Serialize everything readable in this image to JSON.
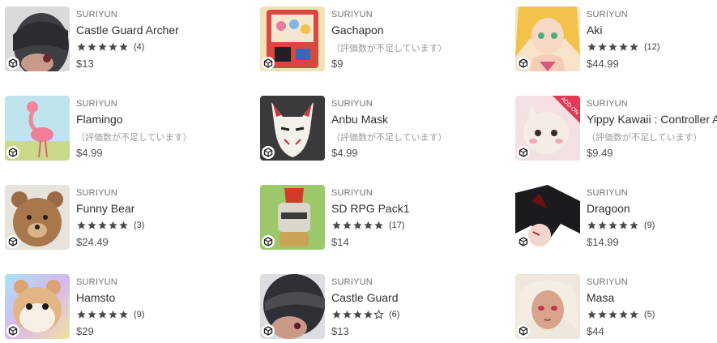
{
  "products": [
    {
      "publisher": "SURIYUN",
      "title": "Castle Guard Archer",
      "stars": 5,
      "count": "(4)",
      "price": "$13"
    },
    {
      "publisher": "SURIYUN",
      "title": "Gachapon",
      "note": "（評価数が不足しています）",
      "price": "$9"
    },
    {
      "publisher": "SURIYUN",
      "title": "Aki",
      "stars": 5,
      "count": "(12)",
      "price": "$44.99"
    },
    {
      "publisher": "SURIYUN",
      "title": "Flamingo",
      "note": "（評価数が不足しています）",
      "price": "$4.99"
    },
    {
      "publisher": "SURIYUN",
      "title": "Anbu Mask",
      "note": "（評価数が不足しています）",
      "price": "$4.99"
    },
    {
      "publisher": "SURIYUN",
      "title": "Yippy Kawaii : Controller Add-on",
      "note": "（評価数が不足しています）",
      "price": "$9.49",
      "thumb_ribbon": "ADD-ON"
    },
    {
      "publisher": "SURIYUN",
      "title": "Funny Bear",
      "stars": 5,
      "count": "(3)",
      "price": "$24.49"
    },
    {
      "publisher": "SURIYUN",
      "title": "SD RPG Pack1",
      "stars": 5,
      "count": "(17)",
      "price": "$14"
    },
    {
      "publisher": "SURIYUN",
      "title": "Dragoon",
      "stars": 5,
      "count": "(9)",
      "price": "$14.99"
    },
    {
      "publisher": "SURIYUN",
      "title": "Hamsto",
      "stars": 5,
      "count": "(9)",
      "price": "$29"
    },
    {
      "publisher": "SURIYUN",
      "title": "Castle Guard",
      "stars": 4,
      "count": "(6)",
      "price": "$13"
    },
    {
      "publisher": "SURIYUN",
      "title": "Masa",
      "stars": 5,
      "count": "(5)",
      "price": "$44"
    }
  ],
  "colors": {
    "star": "#4a4a4a",
    "star_empty": "#4a4a4a",
    "accent": "#303030"
  },
  "icons": {
    "badge": "unity-logo-icon",
    "star_full": "star-filled-icon",
    "star_empty": "star-outline-icon"
  }
}
